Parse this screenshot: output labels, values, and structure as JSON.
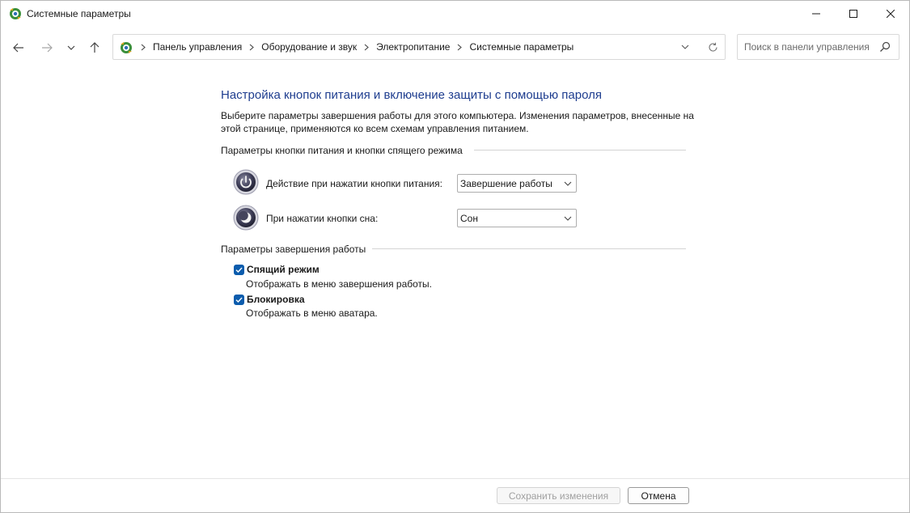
{
  "window": {
    "title": "Системные параметры"
  },
  "address": {
    "crumbs": [
      "Панель управления",
      "Оборудование и звук",
      "Электропитание",
      "Системные параметры"
    ]
  },
  "search": {
    "placeholder": "Поиск в панели управления",
    "value": ""
  },
  "content": {
    "heading": "Настройка кнопок питания и включение защиты с помощью пароля",
    "description": "Выберите параметры завершения работы для этого компьютера. Изменения параметров, внесенные на этой странице, применяются ко всем схемам управления питанием.",
    "power_group_title": "Параметры кнопки питания и кнопки спящего режима",
    "power_button_label": "Действие при нажатии кнопки питания:",
    "power_button_value": "Завершение работы",
    "sleep_button_label": "При нажатии кнопки сна:",
    "sleep_button_value": "Сон",
    "shutdown_group_title": "Параметры завершения работы",
    "options": [
      {
        "label": "Спящий режим",
        "description": "Отображать в меню завершения работы.",
        "checked": true
      },
      {
        "label": "Блокировка",
        "description": "Отображать в меню аватара.",
        "checked": true
      }
    ]
  },
  "footer": {
    "save_label": "Сохранить изменения",
    "cancel_label": "Отмена"
  },
  "icons": {
    "app": "control-panel-icon",
    "back": "arrow-left-icon",
    "forward": "arrow-right-icon",
    "recent": "chevron-down-icon",
    "up": "arrow-up-icon",
    "refresh": "refresh-icon",
    "search": "search-icon",
    "power": "power-icon",
    "sleep": "moon-icon"
  },
  "colors": {
    "accent": "#0b5cad",
    "heading": "#1e3d8f"
  }
}
